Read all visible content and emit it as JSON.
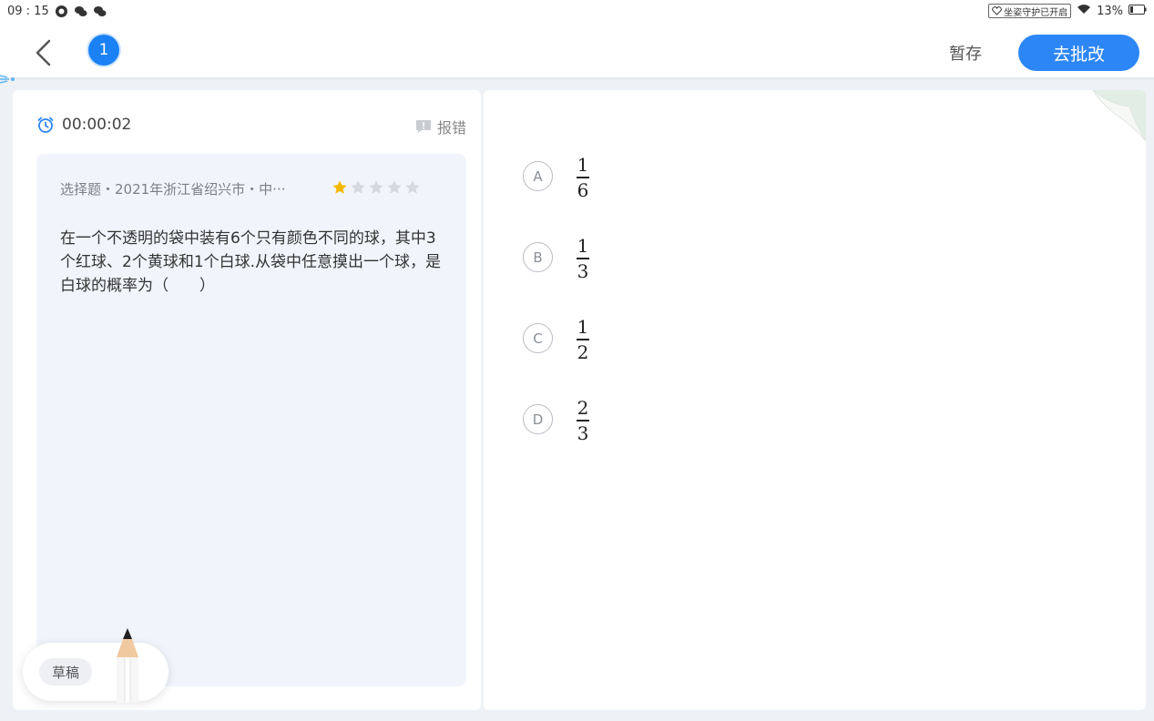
{
  "status_bar": {
    "time": "09 : 15",
    "posture_guard": "坐姿守护已开启",
    "battery": "13%"
  },
  "header": {
    "question_number": "1",
    "save_label": "暂存",
    "submit_label": "去批改"
  },
  "left_panel": {
    "timer": "00:00:02",
    "report_label": "报错",
    "question": {
      "meta": "选择题・2021年浙江省绍兴市・中···",
      "difficulty_stars": 1,
      "difficulty_max": 5,
      "text": "在一个不透明的袋中装有6个只有颜色不同的球，其中3个红球、2个黄球和1个白球.从袋中任意摸出一个球，是白球的概率为（　　）"
    },
    "draft_label": "草稿"
  },
  "options": [
    {
      "letter": "A",
      "numerator": "1",
      "denominator": "6"
    },
    {
      "letter": "B",
      "numerator": "1",
      "denominator": "3"
    },
    {
      "letter": "C",
      "numerator": "1",
      "denominator": "2"
    },
    {
      "letter": "D",
      "numerator": "2",
      "denominator": "3"
    }
  ],
  "colors": {
    "accent": "#2d86f5",
    "star_filled": "#f5b800",
    "star_empty": "#d5d8dd",
    "card_bg": "#f1f5fb"
  },
  "icons": [
    "back-arrow-icon",
    "alarm-clock-icon",
    "report-icon",
    "star-icon",
    "wifi-icon",
    "battery-icon",
    "pencil-icon"
  ]
}
